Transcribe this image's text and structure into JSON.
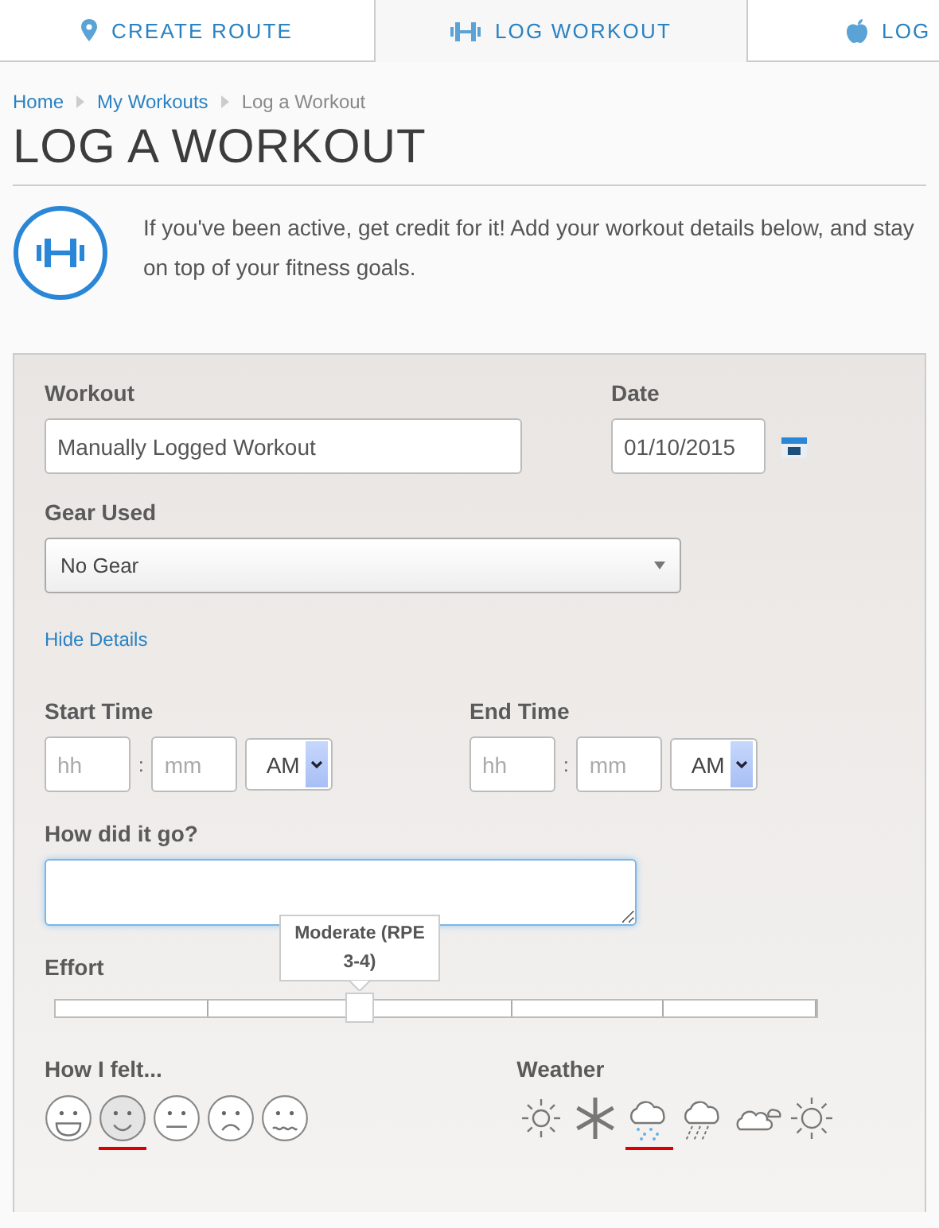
{
  "tabs": [
    {
      "label": "CREATE ROUTE",
      "selected": false
    },
    {
      "label": "LOG WORKOUT",
      "selected": true
    },
    {
      "label": "LOG",
      "selected": false
    }
  ],
  "breadcrumb": [
    {
      "label": "Home",
      "link": true
    },
    {
      "label": "My Workouts",
      "link": true
    },
    {
      "label": "Log a Workout",
      "link": false
    }
  ],
  "title": "LOG A WORKOUT",
  "intro": "If you've been active, get credit for it! Add your workout details below, and stay on top of your fitness goals.",
  "form": {
    "workout": {
      "label": "Workout",
      "value": "Manually Logged Workout"
    },
    "date": {
      "label": "Date",
      "value": "01/10/2015"
    },
    "gear": {
      "label": "Gear Used",
      "value": "No Gear"
    },
    "toggle_details": "Hide Details",
    "start_time": {
      "label": "Start Time",
      "hour_placeholder": "hh",
      "minute_placeholder": "mm",
      "separator": ":",
      "period": "AM"
    },
    "end_time": {
      "label": "End Time",
      "hour_placeholder": "hh",
      "minute_placeholder": "mm",
      "separator": ":",
      "period": "AM"
    },
    "notes": {
      "label": "How did it go?"
    },
    "effort": {
      "label": "Effort",
      "level": 0.4,
      "tooltip": "Moderate (RPE 3-4)"
    },
    "feelings": {
      "label": "How I felt...",
      "options": [
        {
          "kind": "laughing",
          "selected": false
        },
        {
          "kind": "smiling",
          "selected": true
        },
        {
          "kind": "neutral",
          "selected": false
        },
        {
          "kind": "sad",
          "selected": false
        },
        {
          "kind": "queasy",
          "selected": false
        }
      ]
    },
    "weather": {
      "label": "Weather",
      "options": [
        {
          "kind": "hot",
          "selected": false
        },
        {
          "kind": "snowflake",
          "selected": false
        },
        {
          "kind": "snowing",
          "selected": true
        },
        {
          "kind": "rain",
          "selected": false
        },
        {
          "kind": "cloudy",
          "selected": false
        },
        {
          "kind": "sunny",
          "selected": false
        }
      ]
    }
  }
}
